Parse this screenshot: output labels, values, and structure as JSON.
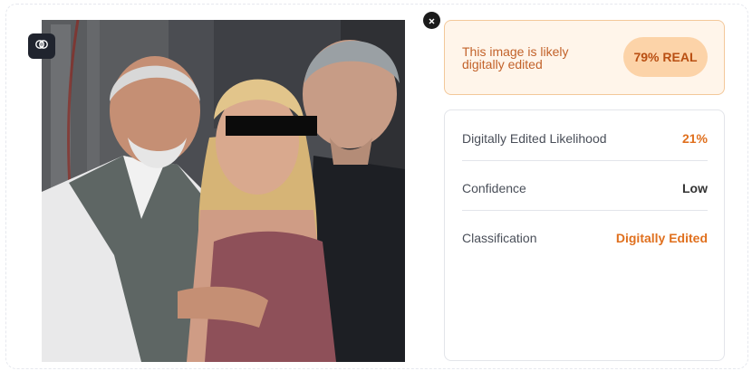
{
  "panel": {
    "verdict_text": "This image is likely digitally edited",
    "verdict_badge": "79% REAL"
  },
  "metrics": [
    {
      "label": "Digitally Edited Likelihood",
      "value": "21%"
    },
    {
      "label": "Confidence",
      "value": "Low"
    },
    {
      "label": "Classification",
      "value": "Digitally Edited"
    }
  ],
  "icons": {
    "analysis_button": "brain-icon",
    "close_button": "close-icon"
  },
  "colors": {
    "verdict_bg": "#fff5ea",
    "verdict_border": "#f3c89a",
    "verdict_text": "#c2622a",
    "badge_bg": "#fcd3a8",
    "badge_text": "#b94f12",
    "value_orange": "#e0701e",
    "value_dark": "#333333"
  }
}
